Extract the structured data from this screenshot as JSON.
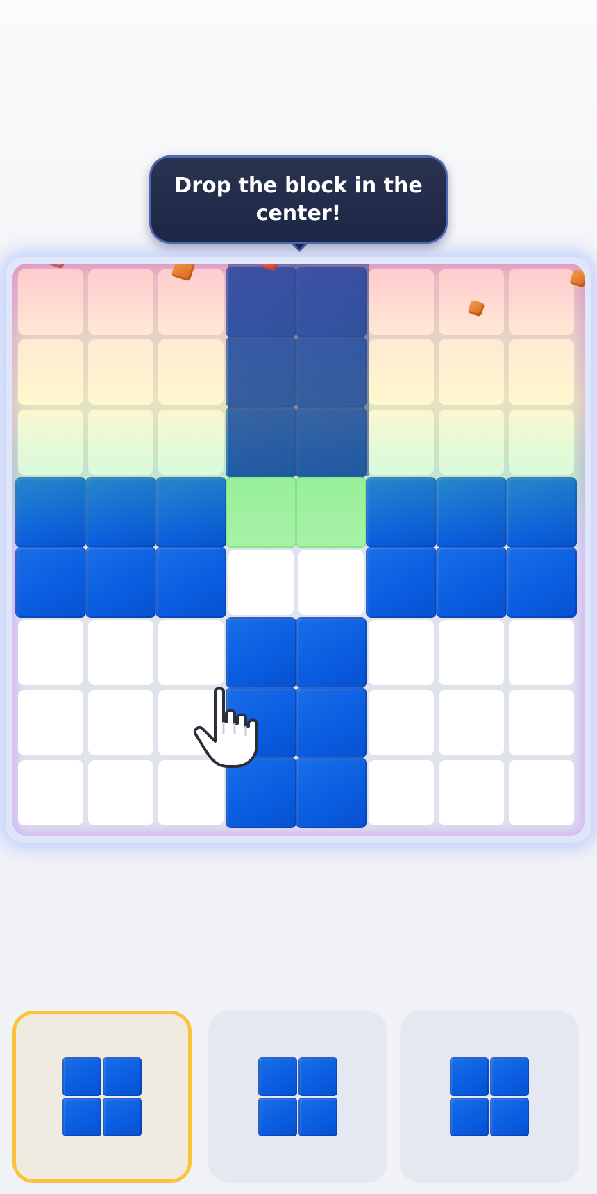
{
  "tutorial": {
    "message": "Drop the block in the center!"
  },
  "board": {
    "rows": 8,
    "cols": 8,
    "filled_cells": [
      [
        0,
        3
      ],
      [
        0,
        4
      ],
      [
        1,
        3
      ],
      [
        1,
        4
      ],
      [
        2,
        3
      ],
      [
        2,
        4
      ],
      [
        3,
        0
      ],
      [
        3,
        1
      ],
      [
        3,
        2
      ],
      [
        3,
        5
      ],
      [
        3,
        6
      ],
      [
        3,
        7
      ],
      [
        4,
        0
      ],
      [
        4,
        1
      ],
      [
        4,
        2
      ],
      [
        4,
        5
      ],
      [
        4,
        6
      ],
      [
        4,
        7
      ],
      [
        5,
        3
      ],
      [
        5,
        4
      ],
      [
        6,
        3
      ],
      [
        6,
        4
      ],
      [
        7,
        3
      ],
      [
        7,
        4
      ]
    ],
    "preview_cells": [
      [
        3,
        3
      ],
      [
        3,
        4
      ]
    ],
    "block_color": "#0a5ce0",
    "preview_color": "#a7f2a8"
  },
  "tray": {
    "pieces": [
      {
        "shape": "square-2x2",
        "selected": true
      },
      {
        "shape": "square-2x2",
        "selected": false
      },
      {
        "shape": "square-2x2",
        "selected": false
      }
    ],
    "selected_border_color": "#fbc33a"
  },
  "icons": {
    "pointer": "hand-pointer-icon"
  }
}
